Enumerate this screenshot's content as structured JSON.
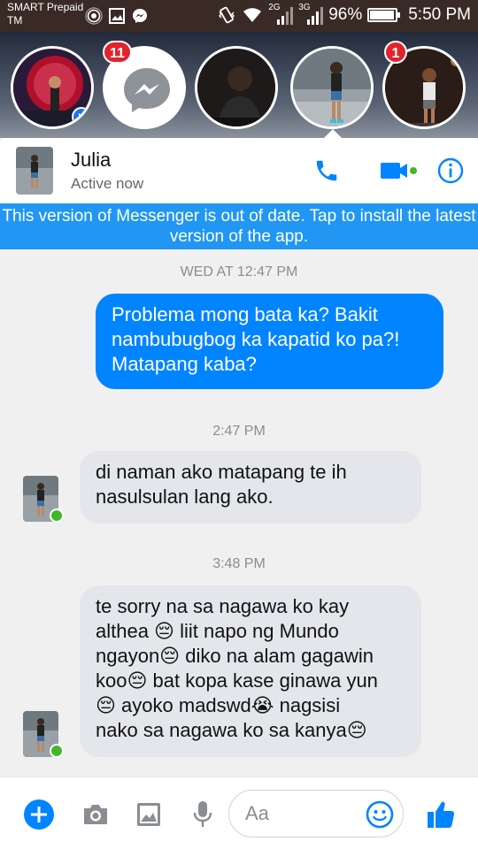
{
  "status_bar": {
    "carrier_line1": "SMART Prepaid",
    "carrier_line2": "TM",
    "net_2g": "2G",
    "net_3g": "3G",
    "battery": "96%",
    "battery_level": 0.96,
    "time": "5:50 PM"
  },
  "chat_heads": [
    {
      "name": "head-1",
      "badge": ""
    },
    {
      "name": "head-messenger",
      "badge": "11"
    },
    {
      "name": "head-3",
      "badge": ""
    },
    {
      "name": "head-julia",
      "badge": ""
    },
    {
      "name": "head-5",
      "badge": "1"
    }
  ],
  "header": {
    "name": "Julia",
    "status": "Active now"
  },
  "banner": {
    "text": "This version of Messenger is out of date. Tap to install the latest version of the app."
  },
  "messages": {
    "ts1": "WED AT 12:47 PM",
    "m1": "Problema mong bata ka? Bakit\nnambubugbog ka kapatid ko pa?!\nMatapang kaba?",
    "ts2": "2:47 PM",
    "m2": "di naman ako matapang te ih\nnasulsulan lang ako.",
    "ts3": "3:48 PM",
    "m3": "te sorry na sa nagawa ko kay\nalthea 😔 liit napo ng Mundo\nngayon😔 diko na alam gagawin\nkoo😔 bat kopa kase ginawa yun\n😔 ayoko madswd😭 nagsisi\nnako sa nagawa ko sa kanya😔"
  },
  "composer": {
    "placeholder": "Aa"
  },
  "colors": {
    "accent": "#0084ff",
    "banner": "#2196f3",
    "online": "#42b72a",
    "badge": "#e0242c"
  }
}
